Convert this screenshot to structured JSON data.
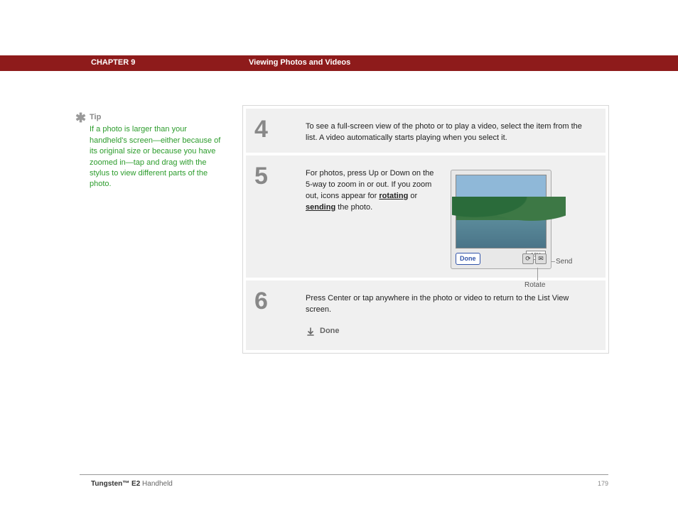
{
  "header": {
    "chapter": "CHAPTER 9",
    "title": "Viewing Photos and Videos"
  },
  "tip": {
    "label": "Tip",
    "text": "If a photo is larger than your handheld's screen—either because of its original size or because you have zoomed in—tap and drag with the stylus to view different parts of the photo."
  },
  "steps": {
    "s4": {
      "num": "4",
      "text": "To see a full-screen view of the photo or to play a video, select the item from the list. A video automatically starts playing when you select it."
    },
    "s5": {
      "num": "5",
      "text_pre": "For photos, press Up or Down on the 5-way to zoom in or out. If you zoom out, icons appear for ",
      "link1": "rotating",
      "text_mid": " or ",
      "link2": "sending",
      "text_post": " the photo.",
      "screenshot": {
        "size_label": "15K",
        "done_label": "Done",
        "callout_send": "Send",
        "callout_rotate": "Rotate"
      }
    },
    "s6": {
      "num": "6",
      "text": "Press Center or tap anywhere in the photo or video to return to the List View screen.",
      "done_label": "Done"
    }
  },
  "footer": {
    "product_bold": "Tungsten™ E2",
    "product_rest": " Handheld",
    "page": "179"
  }
}
